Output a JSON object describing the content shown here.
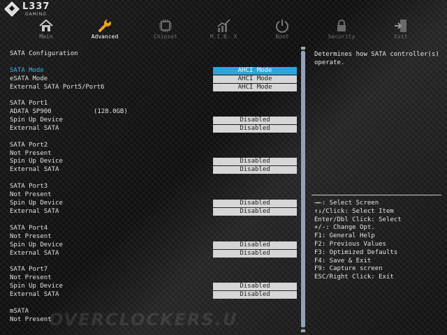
{
  "logo": {
    "brand": "L337",
    "sub": "GAMING"
  },
  "tabs": [
    {
      "label": "Main",
      "icon": "home-icon",
      "state": "normal"
    },
    {
      "label": "Advanced",
      "icon": "wrench-icon",
      "state": "active"
    },
    {
      "label": "Chipset",
      "icon": "chip-icon",
      "state": "dim"
    },
    {
      "label": "M.I.B. X",
      "icon": "graph-icon",
      "state": "dim"
    },
    {
      "label": "Boot",
      "icon": "power-icon",
      "state": "dim"
    },
    {
      "label": "Security",
      "icon": "lock-icon",
      "state": "dim"
    },
    {
      "label": "Exit",
      "icon": "exit-icon",
      "state": "dim"
    }
  ],
  "main": {
    "section_title": "SATA Configuration",
    "rows": [
      {
        "label": "SATA Mode",
        "value": "AHCI Mode",
        "selected": true
      },
      {
        "label": "eSATA Mode",
        "value": "AHCI Mode"
      },
      {
        "label": "External SATA Port5/Port6",
        "value": "AHCI Mode"
      },
      {
        "label": "SATA Port1"
      },
      {
        "label": "ADATA SP900",
        "extra": "(128.0GB)"
      },
      {
        "label": "Spin Up Device",
        "value": "Disabled"
      },
      {
        "label": "External SATA",
        "value": "Disabled"
      },
      {
        "label": "SATA Port2"
      },
      {
        "label": "Not Present"
      },
      {
        "label": "Spin Up Device",
        "value": "Disabled"
      },
      {
        "label": "External SATA",
        "value": "Disabled"
      },
      {
        "label": "SATA Port3"
      },
      {
        "label": "Not Present"
      },
      {
        "label": "Spin Up Device",
        "value": "Disabled"
      },
      {
        "label": "External SATA",
        "value": "Disabled"
      },
      {
        "label": "SATA Port4"
      },
      {
        "label": "Not Present"
      },
      {
        "label": "Spin Up Device",
        "value": "Disabled"
      },
      {
        "label": "External SATA",
        "value": "Disabled"
      },
      {
        "label": "SATA Port7"
      },
      {
        "label": "Not Present"
      },
      {
        "label": "Spin Up Device",
        "value": "Disabled"
      },
      {
        "label": "External SATA",
        "value": "Disabled"
      },
      {
        "label": "mSATA"
      },
      {
        "label": "Not Present"
      }
    ]
  },
  "help": {
    "description": "Determines how SATA controller(s) operate.",
    "keys": [
      "→←: Select Screen",
      "↑↓/Click: Select Item",
      "Enter/Dbl Click: Select",
      "+/-: Change Opt.",
      "F1: General Help",
      "F2: Previous Values",
      "F3: Optimized Defaults",
      "F4: Save & Exit",
      "F9: Capture screen",
      "ESC/Right Click: Exit"
    ]
  },
  "watermark": "OVERCLOCKERS.UA",
  "colors": {
    "accent": "#2ea4dc",
    "highlight_text": "#3ab5ee",
    "option_box": "#d6d6d6",
    "background": "#141414"
  }
}
